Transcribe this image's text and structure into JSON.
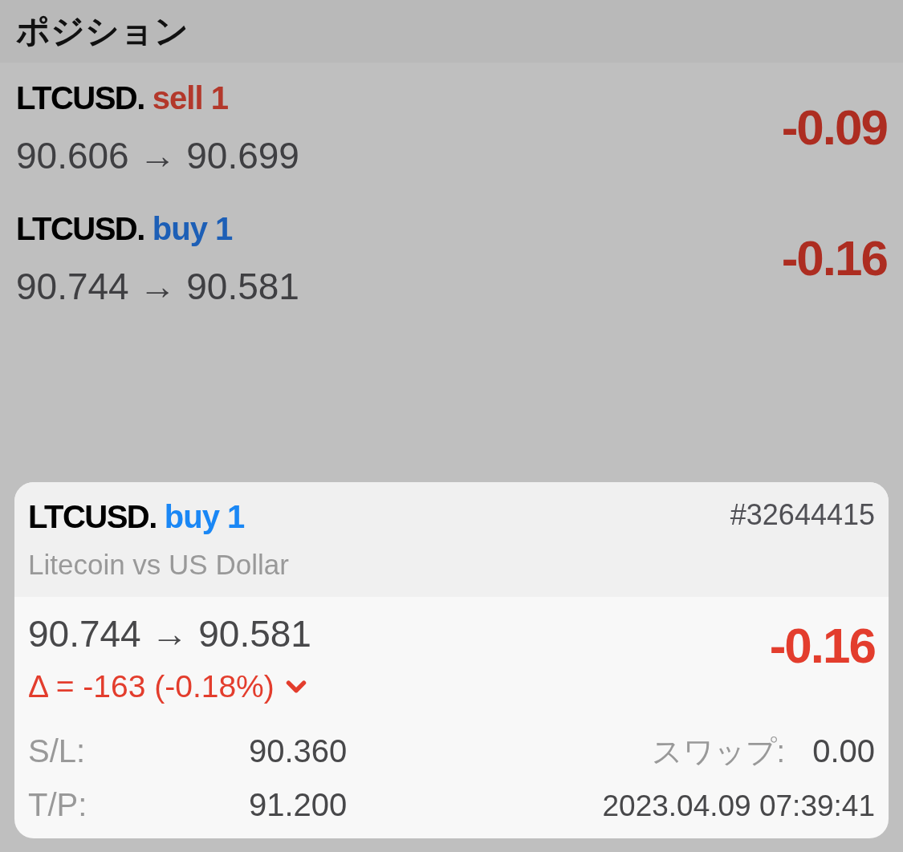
{
  "header": {
    "title": "ポジション"
  },
  "positions": [
    {
      "symbol": "LTCUSD.",
      "order": "sell 1",
      "kind": "sell",
      "prices": "90.606 → 90.699",
      "profit": "-0.09"
    },
    {
      "symbol": "LTCUSD.",
      "order": "buy 1",
      "kind": "buy",
      "prices": "90.744 → 90.581",
      "profit": "-0.16"
    }
  ],
  "detail_card": {
    "symbol": "LTCUSD.",
    "order": "buy 1",
    "kind": "buy",
    "ticket": "#32644415",
    "description": "Litecoin vs US Dollar",
    "prices": "90.744 → 90.581",
    "profit": "-0.16",
    "change": "Δ = -163 (-0.18%)",
    "stop_loss": {
      "label": "S/L:",
      "value": "90.360"
    },
    "take_profit": {
      "label": "T/P:",
      "value": "91.200"
    },
    "swap": {
      "label": "スワップ:",
      "value": "0.00"
    },
    "time": "2023.04.09 07:39:41"
  }
}
